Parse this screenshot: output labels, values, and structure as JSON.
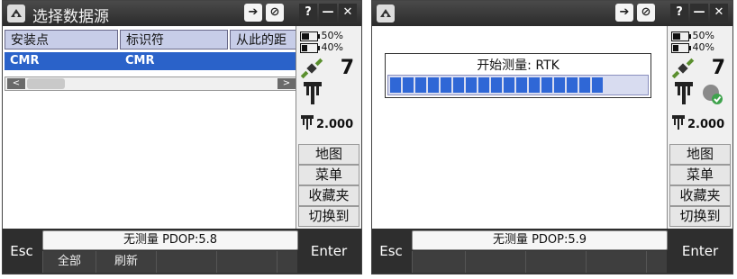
{
  "screen1": {
    "title": "选择数据源",
    "battery": [
      "50%",
      "40%"
    ],
    "satellites": "7",
    "antenna_height": "2.000",
    "table": {
      "headers": [
        "安装点",
        "标识符",
        "从此的距"
      ],
      "rows": [
        [
          "CMR",
          "CMR"
        ]
      ]
    },
    "side_buttons": [
      "地图",
      "菜单",
      "收藏夹",
      "切换到"
    ],
    "status_text": "无测量  PDOP:5.8",
    "softkeys": [
      "全部",
      "刷新"
    ],
    "esc_label": "Esc",
    "enter_label": "Enter"
  },
  "screen2": {
    "battery": [
      "50%",
      "40%"
    ],
    "satellites": "7",
    "antenna_height": "2.000",
    "progress_label": "开始测量: RTK",
    "progress": 0.85,
    "side_buttons": [
      "地图",
      "菜单",
      "收藏夹",
      "切换到"
    ],
    "status_text": "无测量  PDOP:5.9",
    "esc_label": "Esc",
    "enter_label": "Enter"
  },
  "window_controls": [
    "?",
    "—",
    "✕"
  ],
  "colors": {
    "selection": "#2a62c9",
    "progress": "#2f67d6",
    "header": "#c7cde8"
  }
}
